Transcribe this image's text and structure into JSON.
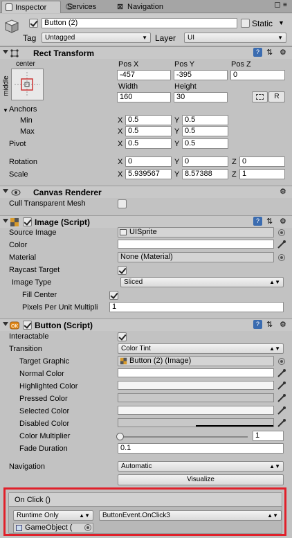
{
  "tabs": [
    {
      "label": "Inspector"
    },
    {
      "label": "Services"
    },
    {
      "label": "Navigation"
    }
  ],
  "object": {
    "name": "Button (2)",
    "static_label": "Static",
    "tag_label": "Tag",
    "tag_value": "Untagged",
    "layer_label": "Layer",
    "layer_value": "UI"
  },
  "rect_transform": {
    "title": "Rect Transform",
    "anchor_h": "center",
    "anchor_v": "middle",
    "pos_x_label": "Pos X",
    "pos_y_label": "Pos Y",
    "pos_z_label": "Pos Z",
    "pos_x": "-457",
    "pos_y": "-395",
    "pos_z": "0",
    "width_label": "Width",
    "height_label": "Height",
    "width": "160",
    "height": "30",
    "r_button": "R",
    "anchors_label": "Anchors",
    "min_label": "Min",
    "max_label": "Max",
    "min_x": "0.5",
    "min_y": "0.5",
    "max_x": "0.5",
    "max_y": "0.5",
    "pivot_label": "Pivot",
    "pivot_x": "0.5",
    "pivot_y": "0.5",
    "rotation_label": "Rotation",
    "rot_x": "0",
    "rot_y": "0",
    "rot_z": "0",
    "scale_label": "Scale",
    "scale_x": "5.939567",
    "scale_y": "8.57388",
    "scale_z": "1",
    "x": "X",
    "y": "Y",
    "z": "Z"
  },
  "canvas_renderer": {
    "title": "Canvas Renderer",
    "cull_label": "Cull Transparent Mesh"
  },
  "image": {
    "title": "Image (Script)",
    "source_label": "Source Image",
    "source_value": "UISprite",
    "color_label": "Color",
    "material_label": "Material",
    "material_value": "None (Material)",
    "raycast_label": "Raycast Target",
    "type_label": "Image Type",
    "type_value": "Sliced",
    "fill_label": "Fill Center",
    "ppu_label": "Pixels Per Unit Multipli",
    "ppu_value": "1"
  },
  "button": {
    "title": "Button (Script)",
    "interactable_label": "Interactable",
    "transition_label": "Transition",
    "transition_value": "Color Tint",
    "target_label": "Target Graphic",
    "target_value": "Button (2) (Image)",
    "normal_label": "Normal Color",
    "highlighted_label": "Highlighted Color",
    "pressed_label": "Pressed Color",
    "selected_label": "Selected Color",
    "disabled_label": "Disabled Color",
    "multiplier_label": "Color Multiplier",
    "multiplier_value": "1",
    "multiplier_fraction": 0.0,
    "fade_label": "Fade Duration",
    "fade_value": "0.1",
    "navigation_label": "Navigation",
    "navigation_value": "Automatic",
    "visualize_label": "Visualize"
  },
  "onclick": {
    "title": "On Click ()",
    "runtime_value": "Runtime Only",
    "function_value": "ButtonEvent.OnClick3",
    "object_value": "GameObject ("
  },
  "colors": {
    "highlight_border": "#e0202a",
    "panel_bg": "#c2c2c2",
    "tab_active": "#cbcbcb"
  }
}
